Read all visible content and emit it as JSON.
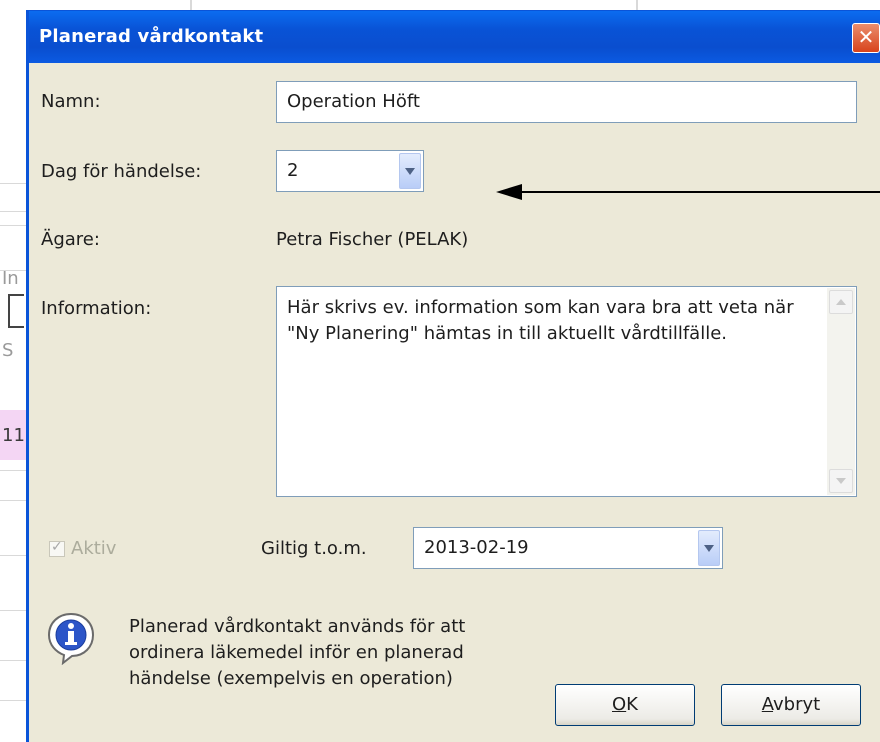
{
  "background": {
    "fragments": [
      "In",
      "S",
      "11"
    ]
  },
  "dialog": {
    "title": "Planerad vårdkontakt",
    "close_label": "✕",
    "name_label": "Namn:",
    "name_value": "Operation Höft",
    "day_label": "Dag för händelse:",
    "day_value": "2",
    "owner_label": "Ägare:",
    "owner_value": "Petra Fischer (PELAK)",
    "info_label": "Information:",
    "info_text": "Här skrivs ev. information som kan vara bra att veta när \"Ny Planering\" hämtas in till aktuellt vårdtillfälle.",
    "active_label": "Aktiv",
    "active_checked": true,
    "valid_label": "Giltig t.o.m.",
    "valid_value": "2013-02-19",
    "note_text": "Planerad vårdkontakt används för att ordinera läkemedel inför en planerad händelse (exempelvis en operation)",
    "ok_label": "OK",
    "ok_mnemonic": "O",
    "ok_rest": "K",
    "cancel_label": "Avbryt",
    "cancel_mnemonic": "A",
    "cancel_rest": "vbryt"
  },
  "icons": {
    "info": "info-icon",
    "close": "close-icon",
    "dropdown": "chevron-down-icon"
  },
  "colors": {
    "titlebar": "#0a4ecf",
    "dialog_bg": "#ece9d8",
    "close": "#d8431c"
  }
}
